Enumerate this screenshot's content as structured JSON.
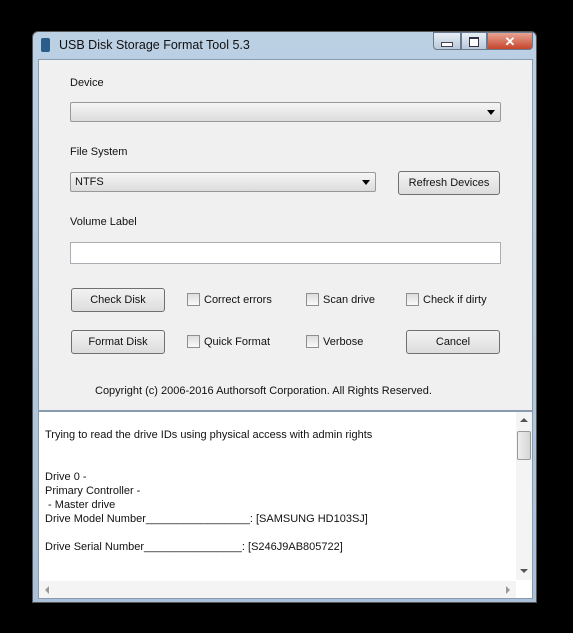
{
  "window": {
    "title": "USB Disk Storage Format Tool 5.3"
  },
  "form": {
    "device_label": "Device",
    "device_value": "",
    "fs_label": "File System",
    "fs_value": "NTFS",
    "refresh": "Refresh Devices",
    "volume_label": "Volume Label",
    "volume_value": "",
    "check_disk": "Check Disk",
    "format_disk": "Format Disk",
    "cancel": "Cancel",
    "checkboxes": [
      {
        "label": "Correct errors",
        "checked": false
      },
      {
        "label": "Scan drive",
        "checked": false
      },
      {
        "label": "Check if dirty",
        "checked": false
      },
      {
        "label": "Quick Format",
        "checked": false
      },
      {
        "label": "Verbose",
        "checked": false
      }
    ],
    "copyright": "Copyright (c) 2006-2016 Authorsoft Corporation. All Rights Reserved."
  },
  "log": {
    "lines": [
      "Trying to read the drive IDs using physical access with admin rights",
      "",
      "",
      "Drive 0 -",
      "Primary Controller -",
      " - Master drive",
      "Drive Model Number_________________: [SAMSUNG HD103SJ]",
      "",
      "Drive Serial Number________________: [S246J9AB805722]"
    ]
  }
}
